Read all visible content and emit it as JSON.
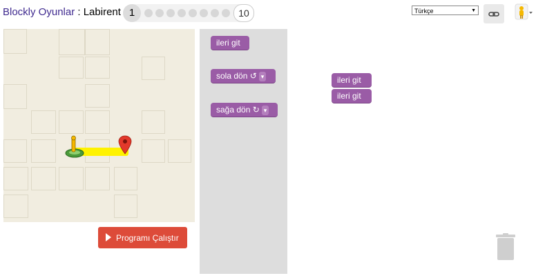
{
  "header": {
    "title_link": "Blockly Oyunlar",
    "title_sep": " : ",
    "title_game": "Labirent",
    "current_level": "1",
    "last_level": "10",
    "language": "Türkçe"
  },
  "toolbox": {
    "move_forward": "ileri git",
    "turn_left": "sola dön ↺",
    "turn_right": "sağa dön ↻",
    "dropdown_arrow": "▾"
  },
  "workspace": {
    "blocks": [
      "ileri git",
      "ileri git"
    ]
  },
  "run_button": {
    "label": "Programı Çalıştır"
  },
  "icons": {
    "link": "link-icon",
    "avatar": "pegman-icon",
    "trash": "trash-icon",
    "play": "play-icon",
    "marker": "map-marker-icon"
  },
  "colors": {
    "block_purple": "#9a5ca6",
    "run_red": "#dd4b39",
    "path_yellow": "#fff200",
    "title_link": "#3f2a8f"
  }
}
